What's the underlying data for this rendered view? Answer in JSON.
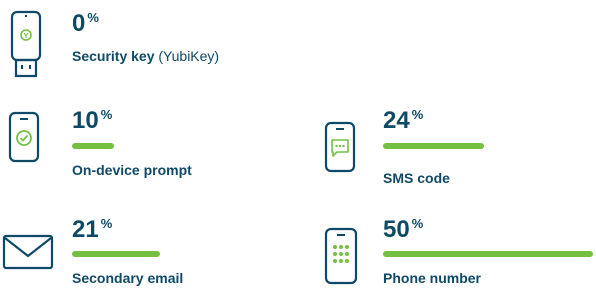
{
  "chart_data": {
    "type": "bar",
    "categories": [
      "Security key",
      "On-device prompt",
      "SMS code",
      "Secondary email",
      "Phone number"
    ],
    "values": [
      0,
      10,
      24,
      21,
      50
    ],
    "unit": "%",
    "bar_color": "#75c043",
    "text_color": "#0e4a66"
  },
  "items": [
    {
      "value": "0",
      "unit": "%",
      "label": "Security key",
      "label_sub": " (YubiKey)",
      "icon": "usb-security-key-icon"
    },
    {
      "value": "10",
      "unit": "%",
      "label": "On-device prompt",
      "label_sub": "",
      "icon": "phone-checkmark-icon"
    },
    {
      "value": "24",
      "unit": "%",
      "label": "SMS code",
      "label_sub": "",
      "icon": "phone-message-icon"
    },
    {
      "value": "21",
      "unit": "%",
      "label": "Secondary email",
      "label_sub": "",
      "icon": "envelope-icon"
    },
    {
      "value": "50",
      "unit": "%",
      "label": "Phone number",
      "label_sub": "",
      "icon": "phone-keypad-icon"
    }
  ]
}
